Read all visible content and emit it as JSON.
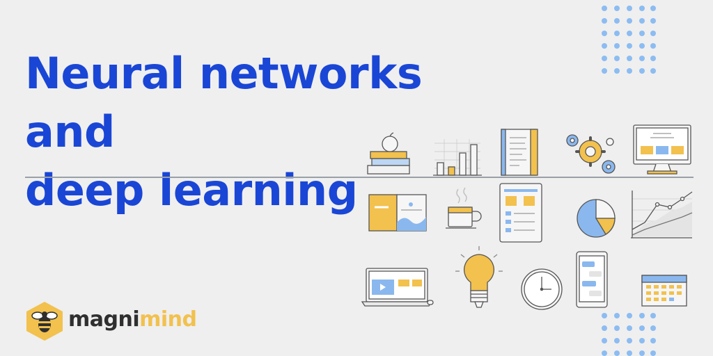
{
  "banner": {
    "title_lines": [
      "Neural networks",
      "and",
      "deep learning"
    ],
    "colors": {
      "headline": "#1a46d6",
      "accent_yellow": "#f2c14e",
      "accent_blue": "#8ab8ee",
      "dots": "#8cbcf2",
      "background": "#efefef"
    }
  },
  "brand": {
    "name_part1": "magni",
    "name_part2": "mind",
    "logo_icon": "bee-hexagon-logo"
  },
  "illustrations": [
    "apple-books-icon",
    "bar-chart-icon",
    "document-icon",
    "gears-icon",
    "monitor-icon",
    "brochure-icon",
    "coffee-cup-icon",
    "tablet-layout-icon",
    "pie-chart-icon",
    "line-chart-icon",
    "laptop-video-icon",
    "lightbulb-icon",
    "clock-icon",
    "smartphone-chat-icon",
    "calendar-icon"
  ]
}
